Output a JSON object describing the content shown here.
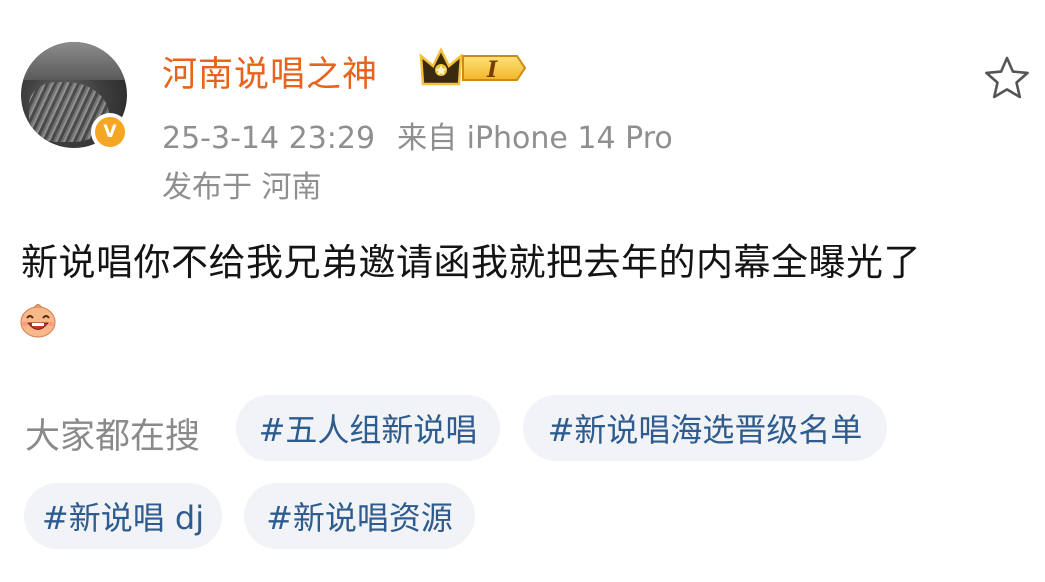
{
  "post": {
    "username": "河南说唱之神",
    "vip_level": "I",
    "timestamp": "25-3-14 23:29",
    "source": "来自 iPhone 14 Pro",
    "location": "发布于 河南",
    "text": "新说唱你不给我兄弟邀请函我就把去年的内幕全曝光了",
    "emoji_icon": "laughing-face-emoji"
  },
  "search": {
    "label": "大家都在搜",
    "tags": [
      "#五人组新说唱",
      "#新说唱海选晋级名单",
      "#新说唱 dj",
      "#新说唱资源"
    ]
  },
  "colors": {
    "username": "#e8631c",
    "meta": "#8f8f8f",
    "tag_text": "#2f5c8f",
    "tag_bg": "#f1f3f7",
    "verified": "#f5a623"
  },
  "icons": [
    "verified-icon",
    "crown-vip-icon",
    "star-icon",
    "laughing-face-emoji"
  ]
}
